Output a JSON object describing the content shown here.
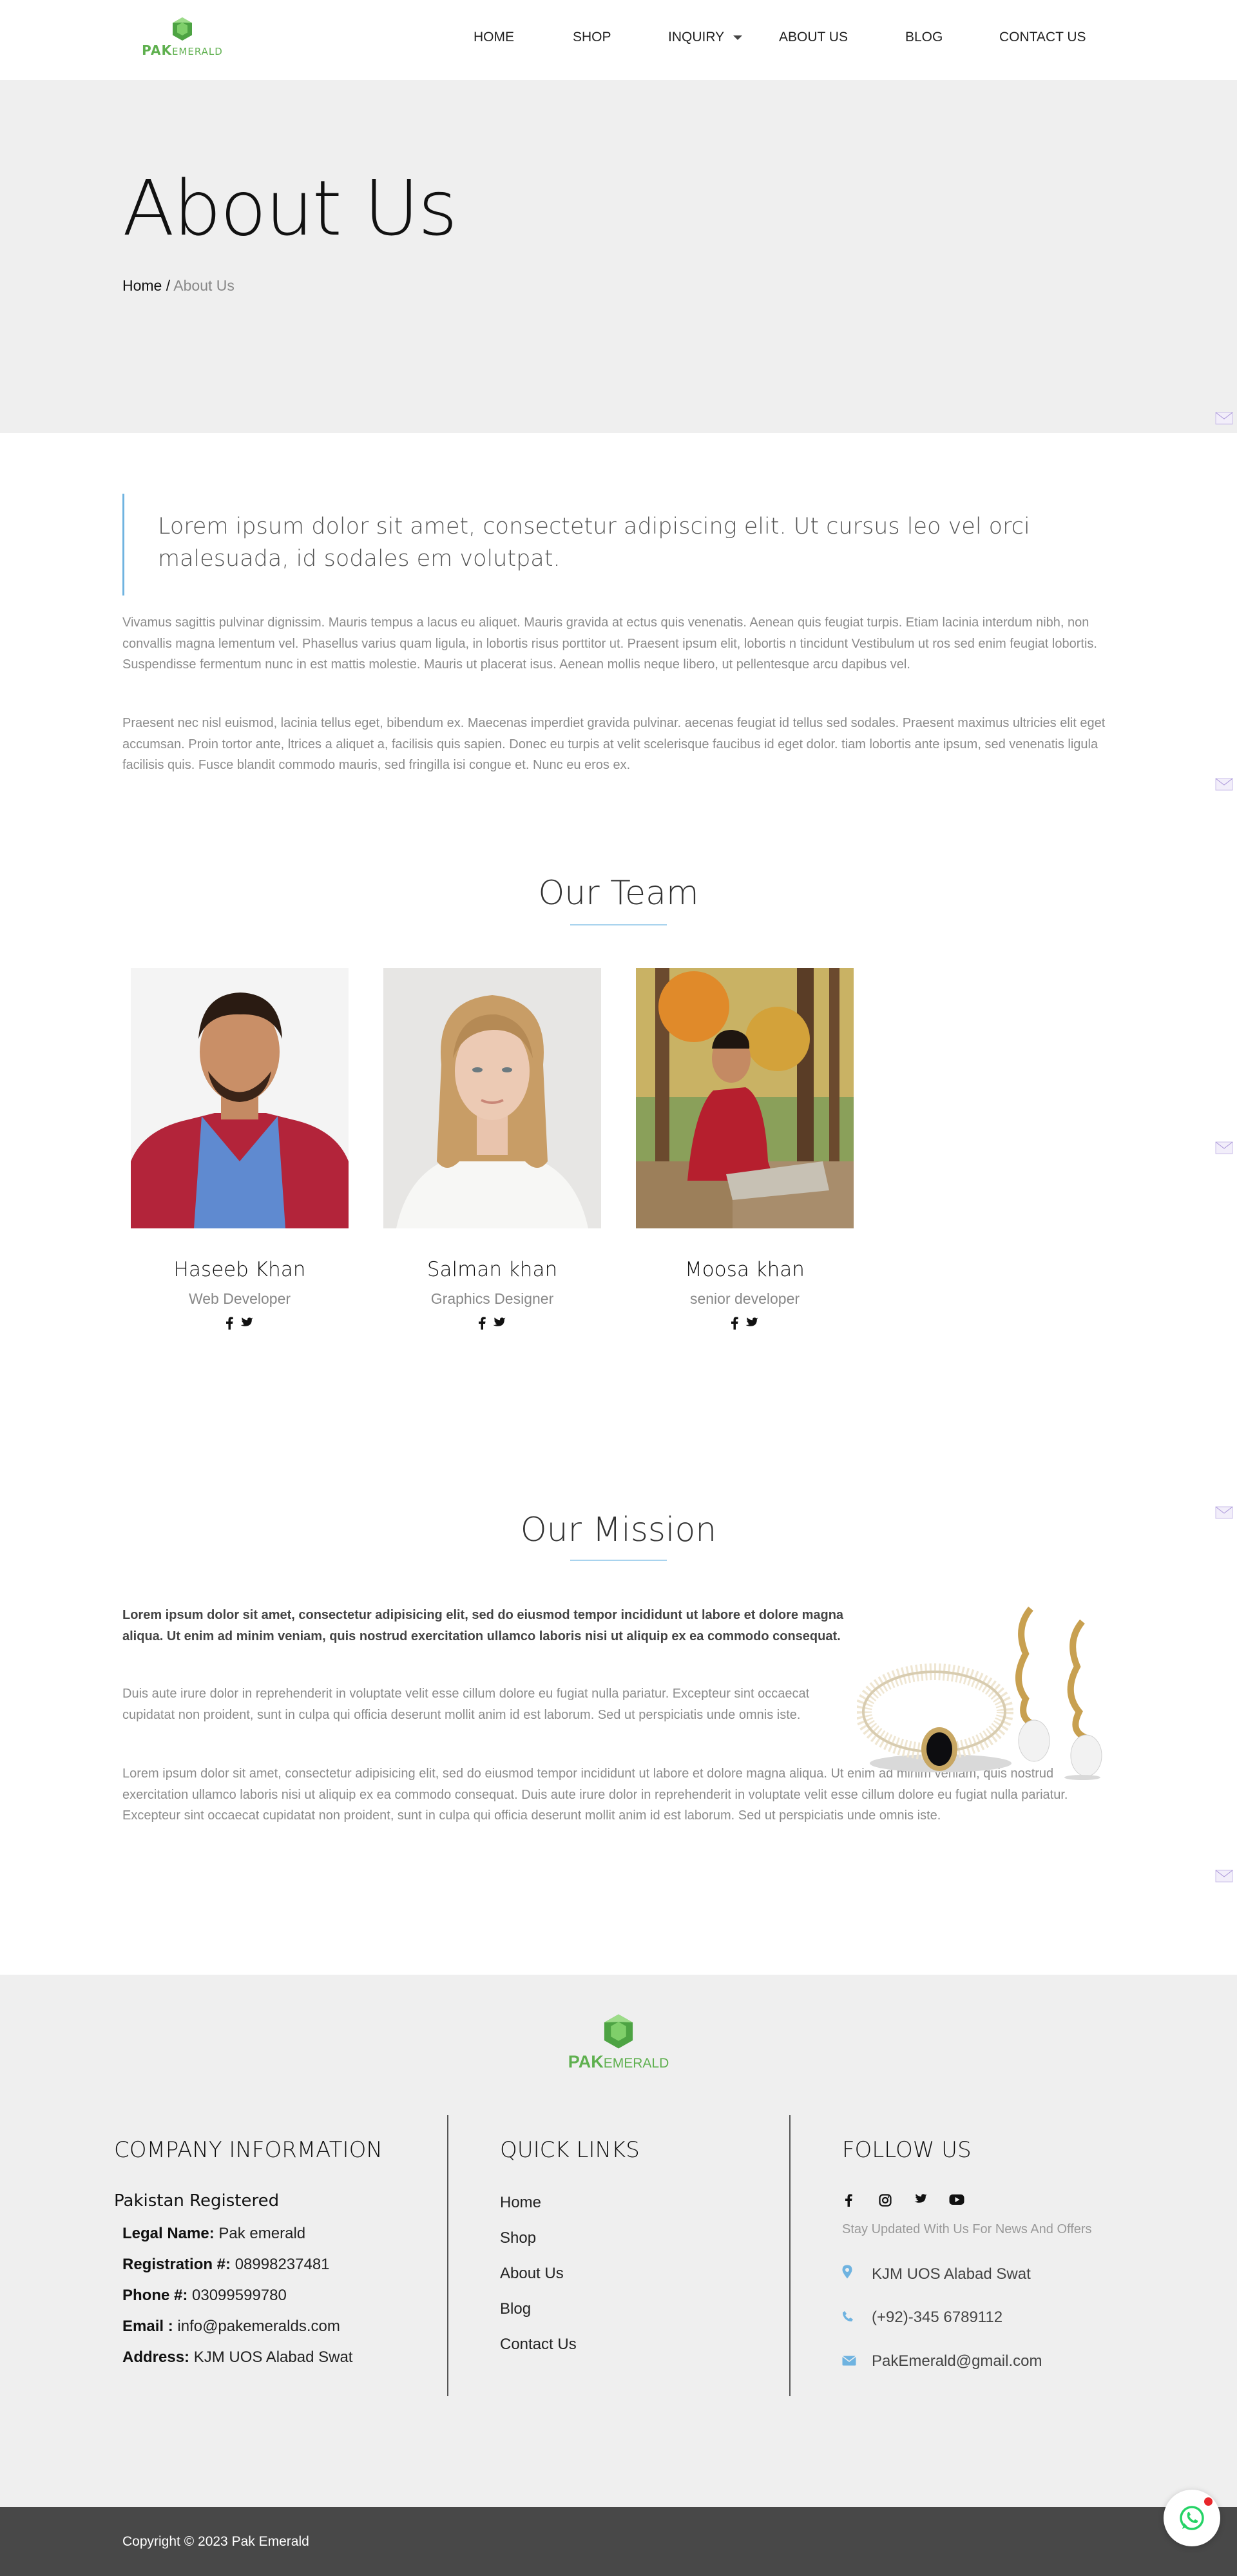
{
  "header": {
    "logo": {
      "pak": "PAK",
      "emerald": "EMERALD"
    },
    "nav": [
      {
        "label": "HOME"
      },
      {
        "label": "SHOP"
      },
      {
        "label": "INQUIRY"
      },
      {
        "label": "ABOUT US"
      },
      {
        "label": "BLOG"
      },
      {
        "label": "CONTACT US"
      }
    ]
  },
  "banner": {
    "title": "About Us",
    "breadcrumb": {
      "home": "Home",
      "separator": " / ",
      "current": "About Us"
    }
  },
  "intro": {
    "quote": "Lorem ipsum dolor sit amet, consectetur adipiscing elit. Ut cursus leo vel orci malesuada, id sodales em volutpat.",
    "paragraphs": [
      "Vivamus sagittis pulvinar dignissim. Mauris tempus a lacus eu aliquet. Mauris gravida at ectus quis venenatis. Aenean quis feugiat turpis. Etiam lacinia interdum nibh, non convallis magna lementum vel. Phasellus varius quam ligula, in lobortis risus porttitor ut. Praesent ipsum elit, lobortis n tincidunt Vestibulum ut ros sed enim feugiat lobortis. Suspendisse fermentum nunc in est mattis molestie. Mauris ut placerat isus. Aenean mollis neque libero, ut pellentesque arcu dapibus vel.",
      "Praesent nec nisl euismod, lacinia tellus eget, bibendum ex. Maecenas imperdiet gravida pulvinar. aecenas feugiat id tellus sed sodales. Praesent maximus ultricies elit eget accumsan. Proin tortor ante, ltrices a aliquet a, facilisis quis sapien. Donec eu turpis at velit scelerisque faucibus id eget dolor. tiam lobortis ante ipsum, sed venenatis ligula facilisis quis. Fusce blandit commodo mauris, sed fringilla isi congue et. Nunc eu eros ex."
    ]
  },
  "team": {
    "title": "Our Team",
    "members": [
      {
        "name": "Haseeb Khan",
        "role": "Web Developer"
      },
      {
        "name": "Salman khan",
        "role": "Graphics Designer"
      },
      {
        "name": "Moosa khan",
        "role": "senior developer"
      }
    ]
  },
  "mission": {
    "title": "Our Mission",
    "bold": "Lorem ipsum dolor sit amet, consectetur adipisicing elit, sed do eiusmod tempor incididunt ut labore et dolore magna aliqua. Ut enim ad minim veniam, quis nostrud exercitation ullamco laboris nisi ut aliquip ex ea commodo consequat.",
    "p1": "Duis aute irure dolor in reprehenderit in voluptate velit esse cillum dolore eu fugiat nulla pariatur. Excepteur sint occaecat cupidatat non proident, sunt in culpa qui officia deserunt mollit anim id est laborum. Sed ut perspiciatis unde omnis iste.",
    "p2": "Lorem ipsum dolor sit amet, consectetur adipisicing elit, sed do eiusmod tempor incididunt ut labore et dolore magna aliqua. Ut enim ad minim veniam, quis nostrud exercitation ullamco laboris nisi ut aliquip ex ea commodo consequat. Duis aute irure dolor in reprehenderit in voluptate velit esse cillum dolore eu fugiat nulla pariatur. Excepteur sint occaecat cupidatat non proident, sunt in culpa qui officia deserunt mollit anim id est laborum. Sed ut perspiciatis unde omnis iste."
  },
  "footer": {
    "logo": {
      "pak": "PAK",
      "emerald": "EMERALD"
    },
    "company": {
      "title": "COMPANY INFORMATION",
      "heading": "Pakistan Registered",
      "rows": [
        {
          "label": "Legal Name:",
          "value": " Pak emerald"
        },
        {
          "label": "Registration #:",
          "value": " 08998237481"
        },
        {
          "label": "Phone #:",
          "value": " 03099599780"
        },
        {
          "label": "Email :",
          "value": " info@pakemeralds.com"
        },
        {
          "label": "Address:",
          "value": " KJM UOS Alabad Swat"
        }
      ]
    },
    "quick_links": {
      "title": "QUICK LINKS",
      "links": [
        "Home",
        "Shop",
        "About Us",
        "Blog",
        "Contact Us"
      ]
    },
    "follow": {
      "title": "FOLLOW US",
      "icons": [
        "facebook-icon",
        "instagram-icon",
        "twitter-icon",
        "youtube-icon"
      ],
      "tagline": "Stay Updated With Us For News And Offers",
      "contacts": [
        {
          "icon": "location-pin-icon",
          "text": "KJM UOS Alabad Swat"
        },
        {
          "icon": "phone-icon",
          "text": "(+92)-345 6789112"
        },
        {
          "icon": "envelope-icon",
          "text": "PakEmerald@gmail.com"
        }
      ]
    },
    "copyright": "Copyright © 2023 Pak Emerald"
  },
  "colors": {
    "brand_green": "#5fb04f",
    "accent_blue": "#6fb3e0",
    "footer_bg": "#efefef",
    "bottom_bar": "#484848",
    "whatsapp_green": "#25d366",
    "notification_red": "#e8262b"
  }
}
